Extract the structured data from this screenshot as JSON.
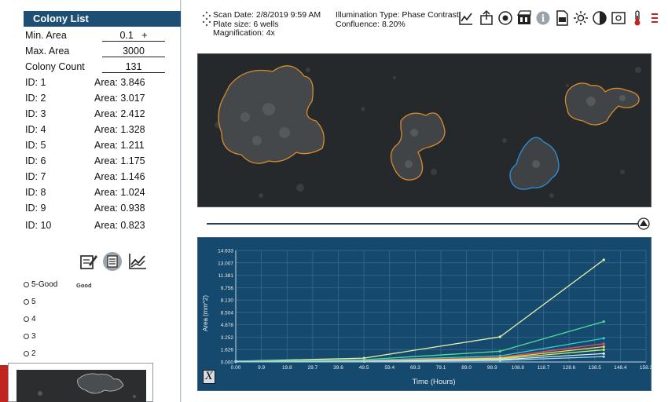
{
  "colony_list": {
    "title": "Colony List",
    "min_area_label": "Min. Area",
    "min_area_value": "0.1",
    "min_area_plus": "+",
    "max_area_label": "Max. Area",
    "max_area_value": "3000",
    "count_label": "Colony Count",
    "count_value": "131",
    "colonies": [
      {
        "id": "ID: 1",
        "area": "Area: 3.846"
      },
      {
        "id": "ID: 2",
        "area": "Area: 3.017"
      },
      {
        "id": "ID: 3",
        "area": "Area: 2.412"
      },
      {
        "id": "ID: 4",
        "area": "Area: 1.328"
      },
      {
        "id": "ID: 5",
        "area": "Area: 1.211"
      },
      {
        "id": "ID: 6",
        "area": "Area: 1.175"
      },
      {
        "id": "ID: 7",
        "area": "Area: 1.146"
      },
      {
        "id": "ID: 8",
        "area": "Area: 1.024"
      },
      {
        "id": "ID: 9",
        "area": "Area: 0.938"
      },
      {
        "id": "ID: 10",
        "area": "Area: 0.823"
      }
    ]
  },
  "grading": {
    "options": [
      "5-Good",
      "5",
      "4",
      "3",
      "2"
    ],
    "tag": "Good"
  },
  "scan_info": {
    "scan_date": "Scan Date: 2/8/2019 9:59 AM",
    "plate_size": "Plate size: 6 wells",
    "magnification": "Magnification: 4x",
    "illumination": "Illumination Type: Phase Contrast",
    "confluence": "Confluence: 8.20%"
  },
  "toolbar_icons": [
    "chart-line-icon",
    "export-icon",
    "camera-icon",
    "film-icon",
    "info-icon",
    "pdf-icon",
    "brightness-icon",
    "contrast-icon",
    "image-icon",
    "thermometer-icon",
    "menu-icon"
  ],
  "colors": {
    "header": "#1d4e73",
    "chart_bg": "#154a6e",
    "outline_orange": "#d98b2b",
    "outline_blue": "#2f8fd8"
  },
  "x_button": "X",
  "chart_data": {
    "type": "line",
    "title": "",
    "xlabel": "Time (Hours)",
    "ylabel": "Area (mm^2)",
    "x_ticks": [
      "0.00",
      "9.9",
      "19.8",
      "29.7",
      "39.6",
      "49.5",
      "59.4",
      "69.3",
      "79.1",
      "89.0",
      "98.9",
      "108.8",
      "118.7",
      "128.6",
      "138.5",
      "148.4",
      "158.3"
    ],
    "y_ticks": [
      "0.000",
      "1.626",
      "3.252",
      "4.878",
      "6.504",
      "8.130",
      "9.756",
      "11.381",
      "13.007",
      "14.633"
    ],
    "xlim": [
      0,
      158.3
    ],
    "ylim": [
      0,
      14.633
    ],
    "x": [
      0,
      49.5,
      102,
      142
    ],
    "series": [
      {
        "values": [
          0.1,
          0.5,
          3.3,
          13.4
        ],
        "color": "#e8f0a8"
      },
      {
        "values": [
          0.1,
          0.3,
          1.4,
          5.3
        ],
        "color": "#4fdc9a"
      },
      {
        "values": [
          0.1,
          0.2,
          0.8,
          3.1
        ],
        "color": "#2fd0c8"
      },
      {
        "values": [
          0.05,
          0.15,
          0.6,
          2.4
        ],
        "color": "#f04a6a"
      },
      {
        "values": [
          0.05,
          0.1,
          0.5,
          2.0
        ],
        "color": "#ffd24a"
      },
      {
        "values": [
          0.05,
          0.1,
          0.4,
          1.6
        ],
        "color": "#b8f07a"
      },
      {
        "values": [
          0.02,
          0.08,
          0.3,
          1.1
        ],
        "color": "#e0e8f0"
      },
      {
        "values": [
          0.02,
          0.05,
          0.2,
          0.7
        ],
        "color": "#9ad8f0"
      }
    ]
  }
}
